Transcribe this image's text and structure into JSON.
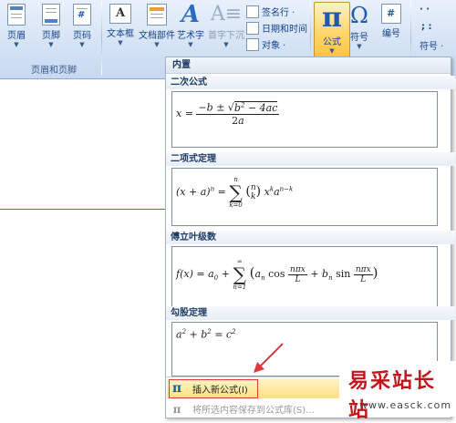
{
  "ribbon": {
    "header_footer_group": {
      "label": "页眉和页脚",
      "buttons": [
        {
          "label": "页眉"
        },
        {
          "label": "页脚"
        },
        {
          "label": "页码"
        }
      ]
    },
    "text_group": {
      "buttons": [
        {
          "label": "文本框"
        },
        {
          "label": "文档部件"
        },
        {
          "label": "艺术字"
        },
        {
          "label": "首字下沉"
        }
      ],
      "small_buttons": [
        {
          "label": "签名行 ·"
        },
        {
          "label": "日期和时间"
        },
        {
          "label": "对象 ·"
        }
      ]
    },
    "symbols_group": {
      "equation": {
        "label": "公式",
        "glyph": "π"
      },
      "symbol": {
        "label": "符号",
        "glyph": "Ω"
      },
      "number": {
        "label": "编号",
        "glyph": "#"
      },
      "extra_label": "符号 ·",
      "extra_top": "· ·",
      "extra_mid": "; :"
    }
  },
  "gallery": {
    "header": "内置",
    "sections": [
      {
        "title": "二次公式",
        "formula": "x = (−b ± √(b² − 4ac)) / 2a"
      },
      {
        "title": "二项式定理",
        "formula": "(x + a)ⁿ = Σ_{k=0}^{n} (n k) xᵏ aⁿ⁻ᵏ"
      },
      {
        "title": "傅立叶级数",
        "formula": "f(x) = a₀ + Σ_{n=1}^{∞} (aₙ cos(nπx/L) + bₙ sin(nπx/L))"
      },
      {
        "title": "勾股定理",
        "formula": "a² + b² = c²"
      }
    ],
    "menu": {
      "insert_new": "插入新公式(I)",
      "save_selection": "将所选内容保存到公式库(S)..."
    }
  },
  "watermark": {
    "title": "易采站长站",
    "url": "www.easck.com"
  },
  "colors": {
    "accent_red": "#e0383e",
    "ribbon_blue": "#15428b",
    "highlight_yellow": "#ffe082"
  }
}
